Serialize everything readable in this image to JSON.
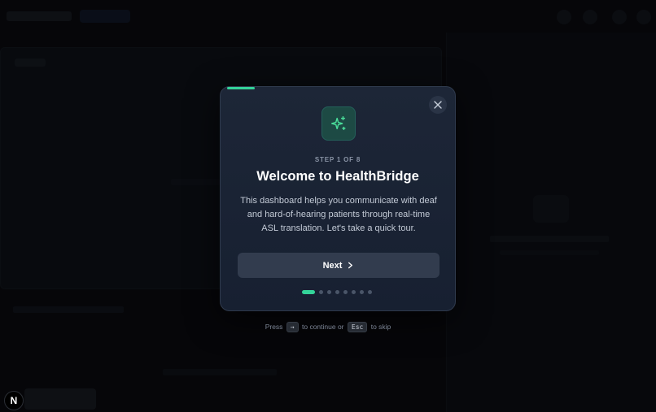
{
  "tour": {
    "step_label": "STEP 1 OF 8",
    "title": "Welcome to HealthBridge",
    "description": "This dashboard helps you communicate with deaf and hard-of-hearing patients through real-time ASL translation. Let's take a quick tour.",
    "next_label": "Next",
    "progress": 0.125,
    "current_step": 1,
    "total_steps": 8,
    "icons": {
      "feature": "sparkles-icon",
      "close": "close-icon",
      "next": "chevron-right-icon"
    },
    "accent_color": "#34d399"
  },
  "hint": {
    "press": "Press",
    "continue_key": "→",
    "to_continue_or": "to continue or",
    "skip_key": "Esc",
    "to_skip": "to skip"
  },
  "dev_badge": {
    "label": "N"
  }
}
